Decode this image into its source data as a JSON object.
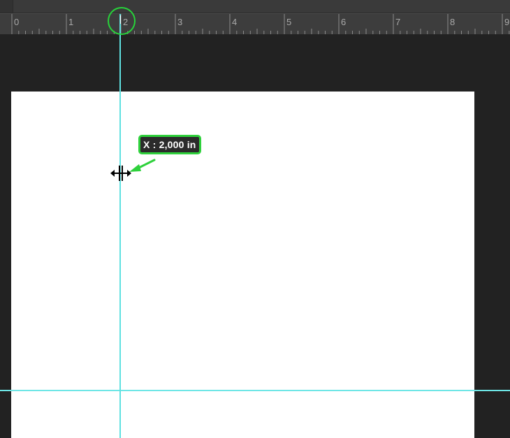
{
  "ruler": {
    "units": "in",
    "labels": [
      "0",
      "1",
      "2",
      "3",
      "4",
      "5",
      "6",
      "7",
      "8",
      "9"
    ]
  },
  "tooltip": {
    "text": "X : 2,000 in"
  },
  "colors": {
    "guide": "#5fe1e1",
    "annotation": "#2fd13c",
    "workspace": "#222222",
    "ruler": "#3d3d3d",
    "canvas": "#ffffff"
  },
  "icons": {
    "cursor": "move-horizontal-cursor-icon",
    "arrow": "annotation-arrow-icon"
  }
}
